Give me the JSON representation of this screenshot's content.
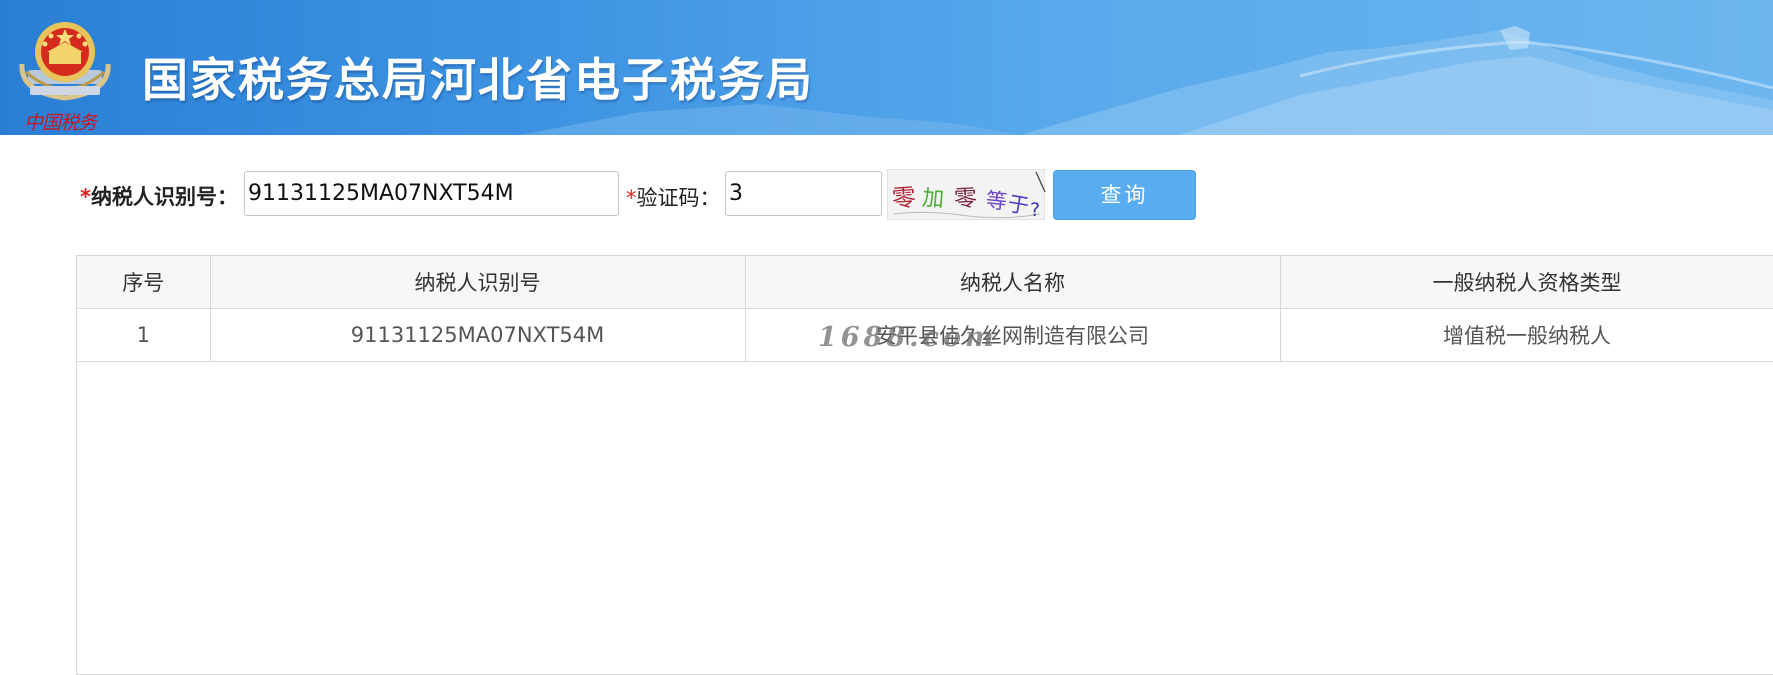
{
  "header": {
    "title": "国家税务总局河北省电子税务局",
    "emblem_script": "中国税务"
  },
  "form": {
    "tin_label": "纳税人识别号",
    "tin_value": "91131125MA07NXT54M",
    "captcha_label": "验证码",
    "captcha_value": "3",
    "captcha_text": "零加零等于?",
    "query_button": "查询",
    "required_mark": "*",
    "colon": "："
  },
  "table": {
    "headers": [
      "序号",
      "纳税人识别号",
      "纳税人名称",
      "一般纳税人资格类型"
    ],
    "rows": [
      [
        "1",
        "91131125MA07NXT54M",
        "安平县佳久丝网制造有限公司",
        "增值税一般纳税人"
      ]
    ]
  },
  "watermark": "1688.com",
  "colors": {
    "banner": "#3d93e2",
    "button": "#5aacf0",
    "required": "#e0211f"
  }
}
